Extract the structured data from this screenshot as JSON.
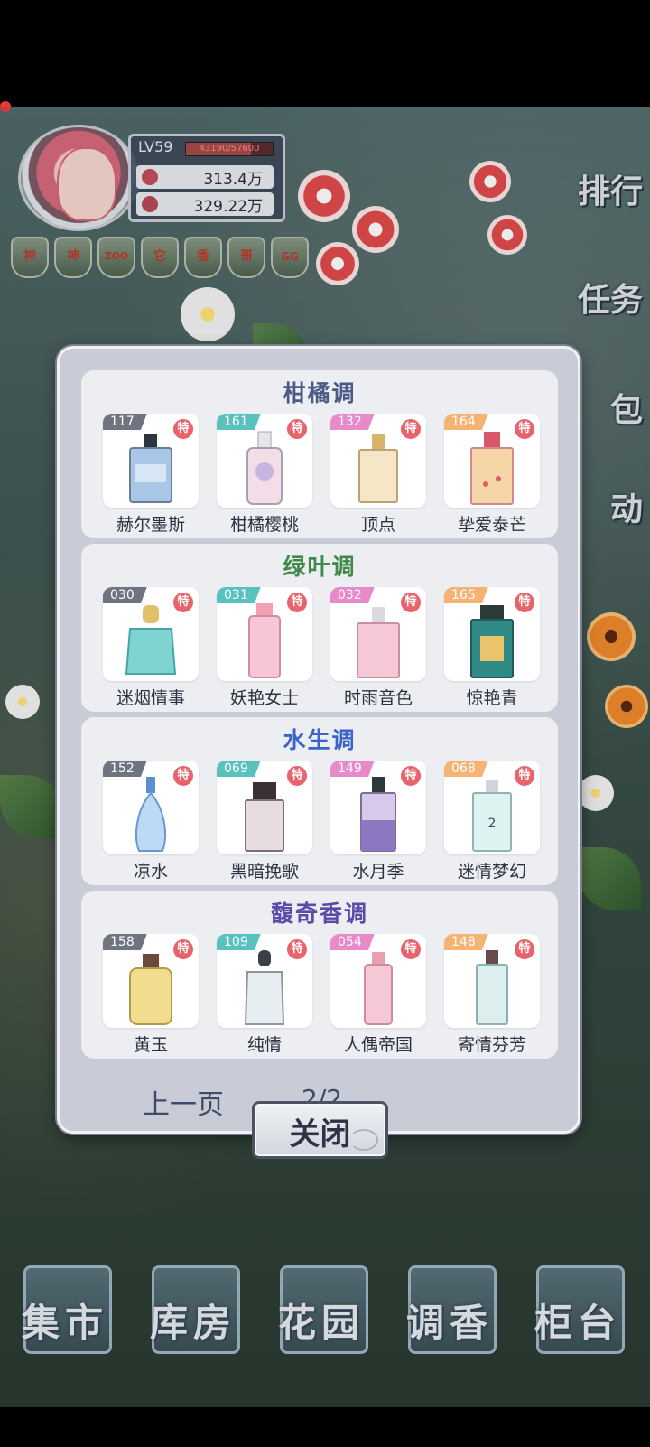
{
  "player": {
    "level": "LV59",
    "exp": "43190/57600",
    "exp_fraction": 0.75,
    "stat1": "313.4万",
    "stat2": "329.22万"
  },
  "badges": [
    "神",
    "神",
    "ZOO",
    "它",
    "香",
    "哥",
    "GG"
  ],
  "right_menu": [
    {
      "label": "排行"
    },
    {
      "label": "任务"
    },
    {
      "label": "包"
    },
    {
      "label": "动"
    }
  ],
  "bottom_nav": [
    {
      "label": "集市"
    },
    {
      "label": "库房"
    },
    {
      "label": "花园"
    },
    {
      "label": "调香"
    },
    {
      "label": "柜台"
    }
  ],
  "modal": {
    "special_label": "特",
    "sections": [
      {
        "title": "柑橘调",
        "title_color": "#4a5a86",
        "items": [
          {
            "num": "117",
            "name": "赫尔墨斯",
            "tag": "gray"
          },
          {
            "num": "161",
            "name": "柑橘樱桃",
            "tag": "teal"
          },
          {
            "num": "132",
            "name": "顶点",
            "tag": "pink"
          },
          {
            "num": "164",
            "name": "挚爱泰芒",
            "tag": "orange"
          }
        ]
      },
      {
        "title": "绿叶调",
        "title_color": "#3f8a4a",
        "items": [
          {
            "num": "030",
            "name": "迷烟情事",
            "tag": "gray"
          },
          {
            "num": "031",
            "name": "妖艳女士",
            "tag": "teal"
          },
          {
            "num": "032",
            "name": "时雨音色",
            "tag": "pink"
          },
          {
            "num": "165",
            "name": "惊艳青",
            "tag": "orange"
          }
        ]
      },
      {
        "title": "水生调",
        "title_color": "#3c64c8",
        "items": [
          {
            "num": "152",
            "name": "凉水",
            "tag": "gray"
          },
          {
            "num": "069",
            "name": "黑暗挽歌",
            "tag": "teal"
          },
          {
            "num": "149",
            "name": "水月季",
            "tag": "pink"
          },
          {
            "num": "068",
            "name": "迷情梦幻",
            "tag": "orange"
          }
        ]
      },
      {
        "title": "馥奇香调",
        "title_color": "#5b4aa8",
        "items": [
          {
            "num": "158",
            "name": "黄玉",
            "tag": "gray"
          },
          {
            "num": "109",
            "name": "纯情",
            "tag": "teal"
          },
          {
            "num": "054",
            "name": "人偶帝国",
            "tag": "pink"
          },
          {
            "num": "148",
            "name": "寄情芬芳",
            "tag": "orange"
          }
        ]
      }
    ],
    "prev_label": "上一页",
    "page": "2/2",
    "close_label": "关闭"
  },
  "bottle_2_label": "2"
}
